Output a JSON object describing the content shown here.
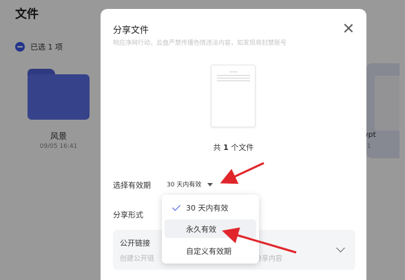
{
  "background": {
    "title": "文件",
    "selected_count": "已选 1 项",
    "folder": {
      "name": "风景",
      "time": "09/05 16:41"
    },
    "file": {
      "name": ".wpt",
      "time": "1"
    }
  },
  "modal": {
    "title": "分享文件",
    "subtitle": "响应净网行动，云盘严禁传播色情违法内容，如发现将封禁账号",
    "file_count_prefix": "共",
    "file_count": "1",
    "file_count_suffix": "个文件",
    "validity_label": "选择有效期",
    "validity_value": "30 天内有效",
    "share_form_label": "分享形式",
    "public_link": {
      "title": "公开链接",
      "desc_left": "创建公开链",
      "desc_right": "分享内容"
    }
  },
  "dropdown": {
    "options": [
      {
        "label": "30 天内有效",
        "selected": true
      },
      {
        "label": "永久有效",
        "selected": false
      },
      {
        "label": "自定义有效期",
        "selected": false
      }
    ]
  },
  "colors": {
    "accent": "#3d57e8",
    "arrow": "#e0262b",
    "folder": "#5b6ee6"
  }
}
